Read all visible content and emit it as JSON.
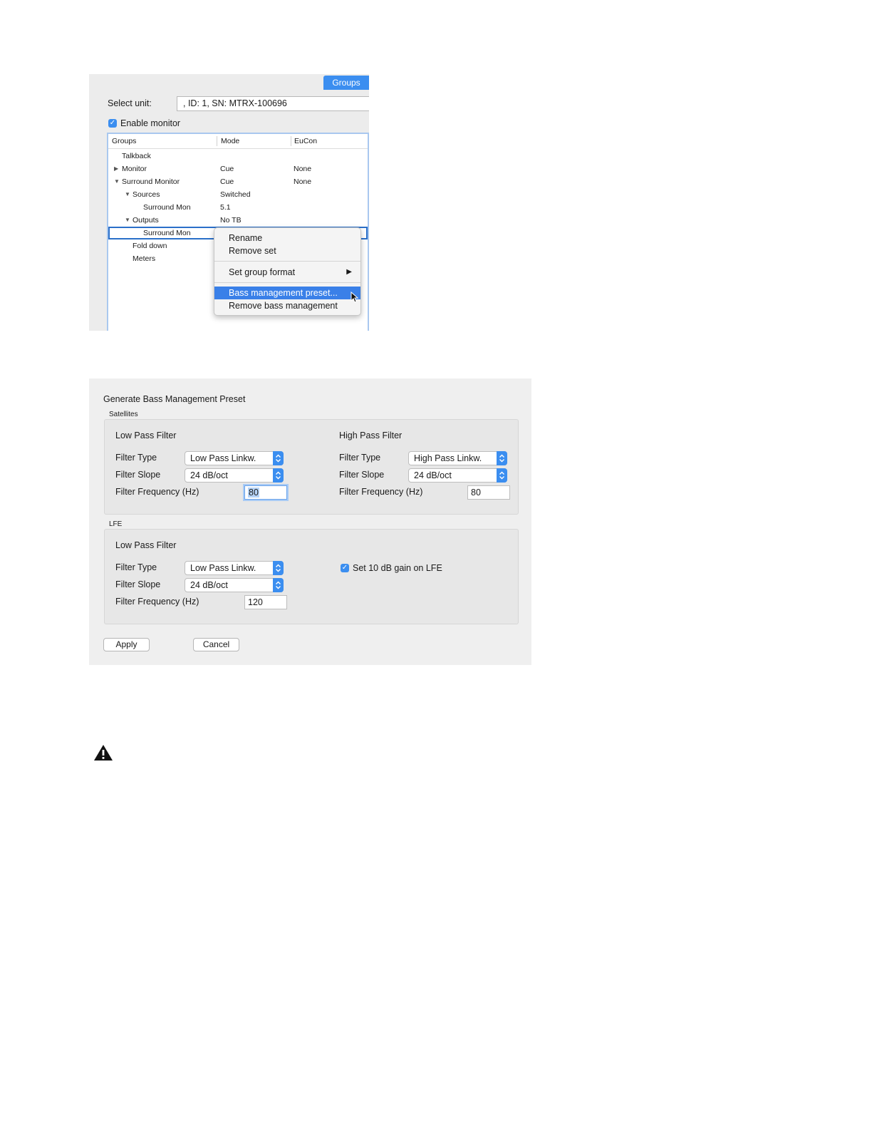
{
  "groups_panel": {
    "tab_label": "Groups",
    "select_unit_label": "Select unit:",
    "unit_value": ", ID: 1, SN: MTRX-100696",
    "enable_monitor_label": "Enable monitor",
    "enable_monitor_checked": true,
    "columns": [
      "Groups",
      "Mode",
      "EuCon"
    ],
    "rows": [
      {
        "name": "Talkback",
        "mode": "",
        "eucon": ""
      },
      {
        "name": "Monitor",
        "mode": "Cue",
        "eucon": "None"
      },
      {
        "name": "Surround Monitor",
        "mode": "Cue",
        "eucon": "None"
      },
      {
        "name": "Sources",
        "mode": "Switched",
        "eucon": ""
      },
      {
        "name": "Surround Mon",
        "mode": "5.1",
        "eucon": ""
      },
      {
        "name": "Outputs",
        "mode": "No TB",
        "eucon": ""
      },
      {
        "name": "Surround Mon",
        "mode": "",
        "eucon": ""
      },
      {
        "name": "Fold down",
        "mode": "",
        "eucon": ""
      },
      {
        "name": "Meters",
        "mode": "",
        "eucon": ""
      }
    ],
    "context_menu": {
      "items": [
        "Rename",
        "Remove set",
        "Set group format",
        "Bass management preset...",
        "Remove bass management"
      ],
      "highlighted": "Bass management preset..."
    }
  },
  "bass_dialog": {
    "title": "Generate Bass Management Preset",
    "satellites_label": "Satellites",
    "lfe_label": "LFE",
    "sat_lpf": {
      "heading": "Low Pass Filter",
      "type_label": "Filter Type",
      "type_value": "Low Pass Linkw.",
      "slope_label": "Filter Slope",
      "slope_value": "24 dB/oct",
      "freq_label": "Filter Frequency (Hz)",
      "freq_value": "80"
    },
    "sat_hpf": {
      "heading": "High Pass Filter",
      "type_label": "Filter Type",
      "type_value": "High Pass Linkw.",
      "slope_label": "Filter Slope",
      "slope_value": "24 dB/oct",
      "freq_label": "Filter Frequency (Hz)",
      "freq_value": "80"
    },
    "lfe_lpf": {
      "heading": "Low Pass Filter",
      "type_label": "Filter Type",
      "type_value": "Low Pass Linkw.",
      "slope_label": "Filter Slope",
      "slope_value": "24 dB/oct",
      "freq_label": "Filter Frequency (Hz)",
      "freq_value": "120"
    },
    "lfe_gain_label": "Set 10 dB gain on LFE",
    "lfe_gain_checked": true,
    "apply_label": "Apply",
    "cancel_label": "Cancel"
  },
  "icons": {
    "warning": "warning-icon"
  },
  "colors": {
    "accent": "#3b8ef0",
    "menu_highlight": "#3a80e8"
  }
}
